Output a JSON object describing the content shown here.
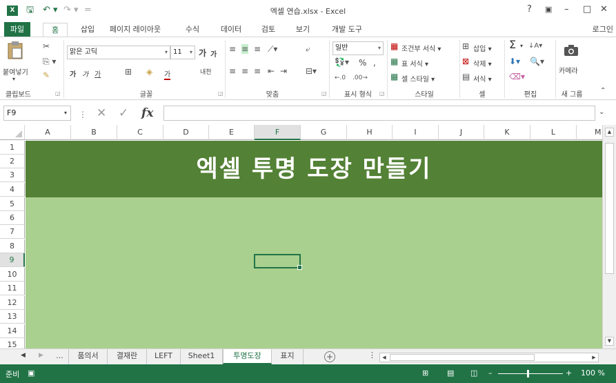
{
  "window": {
    "title": "엑셀 연습.xlsx - Excel",
    "logo_text": "X",
    "controls": [
      "?",
      "▣",
      "–",
      "□",
      "✕"
    ]
  },
  "quick_access": {
    "save_icon": "save-icon",
    "undo_icon": "undo-icon",
    "redo_icon": "redo-icon",
    "customize": "="
  },
  "tabs": [
    {
      "label": "파일"
    },
    {
      "label": "홈"
    },
    {
      "label": "삽입"
    },
    {
      "label": "페이지 레이아웃"
    },
    {
      "label": "수식"
    },
    {
      "label": "데이터"
    },
    {
      "label": "검토"
    },
    {
      "label": "보기"
    },
    {
      "label": "개발 도구"
    }
  ],
  "login_label": "로그인",
  "ribbon": {
    "clipboard": {
      "label": "클립보드",
      "paste": "붙여넣기"
    },
    "font": {
      "label": "글꼴",
      "font_name": "맑은 고딕",
      "font_size": "11",
      "grow": "가",
      "shrink": "가",
      "bold": "가",
      "italic": "가",
      "underline": "가",
      "font_color": "가",
      "phonetic": "내천"
    },
    "alignment": {
      "label": "맞춤"
    },
    "number": {
      "label": "표시 형식",
      "format": "일반",
      "percent": "%",
      "comma": ","
    },
    "styles": {
      "label": "스타일",
      "conditional": "조건부 서식",
      "table": "표 서식",
      "cell_styles": "셀 스타일"
    },
    "cells": {
      "label": "셀",
      "insert": "삽입",
      "delete": "삭제",
      "format": "서식"
    },
    "editing": {
      "label": "편집"
    },
    "new_group": {
      "label": "새 그룹",
      "camera": "카메라"
    }
  },
  "formula_bar": {
    "name_box": "F9",
    "fx": "fx",
    "formula": ""
  },
  "columns": [
    "A",
    "B",
    "C",
    "D",
    "E",
    "F",
    "G",
    "H",
    "I",
    "J",
    "K",
    "L",
    "M"
  ],
  "rows": [
    "1",
    "2",
    "3",
    "4",
    "5",
    "6",
    "7",
    "8",
    "9",
    "10",
    "11",
    "12",
    "13",
    "14",
    "15"
  ],
  "selected_cell": {
    "column": "F",
    "row": "9"
  },
  "banner_text": "엑셀 투명 도장 만들기",
  "colors": {
    "excel_green": "#217346",
    "banner": "#538135",
    "body": "#a9d08e"
  },
  "sheet_tabs": [
    {
      "label": "..."
    },
    {
      "label": "품의서"
    },
    {
      "label": "결재란"
    },
    {
      "label": "LEFT"
    },
    {
      "label": "Sheet1"
    },
    {
      "label": "투명도장",
      "active": true
    },
    {
      "label": "표지"
    }
  ],
  "status": {
    "ready": "준비",
    "zoom": "100 %"
  }
}
